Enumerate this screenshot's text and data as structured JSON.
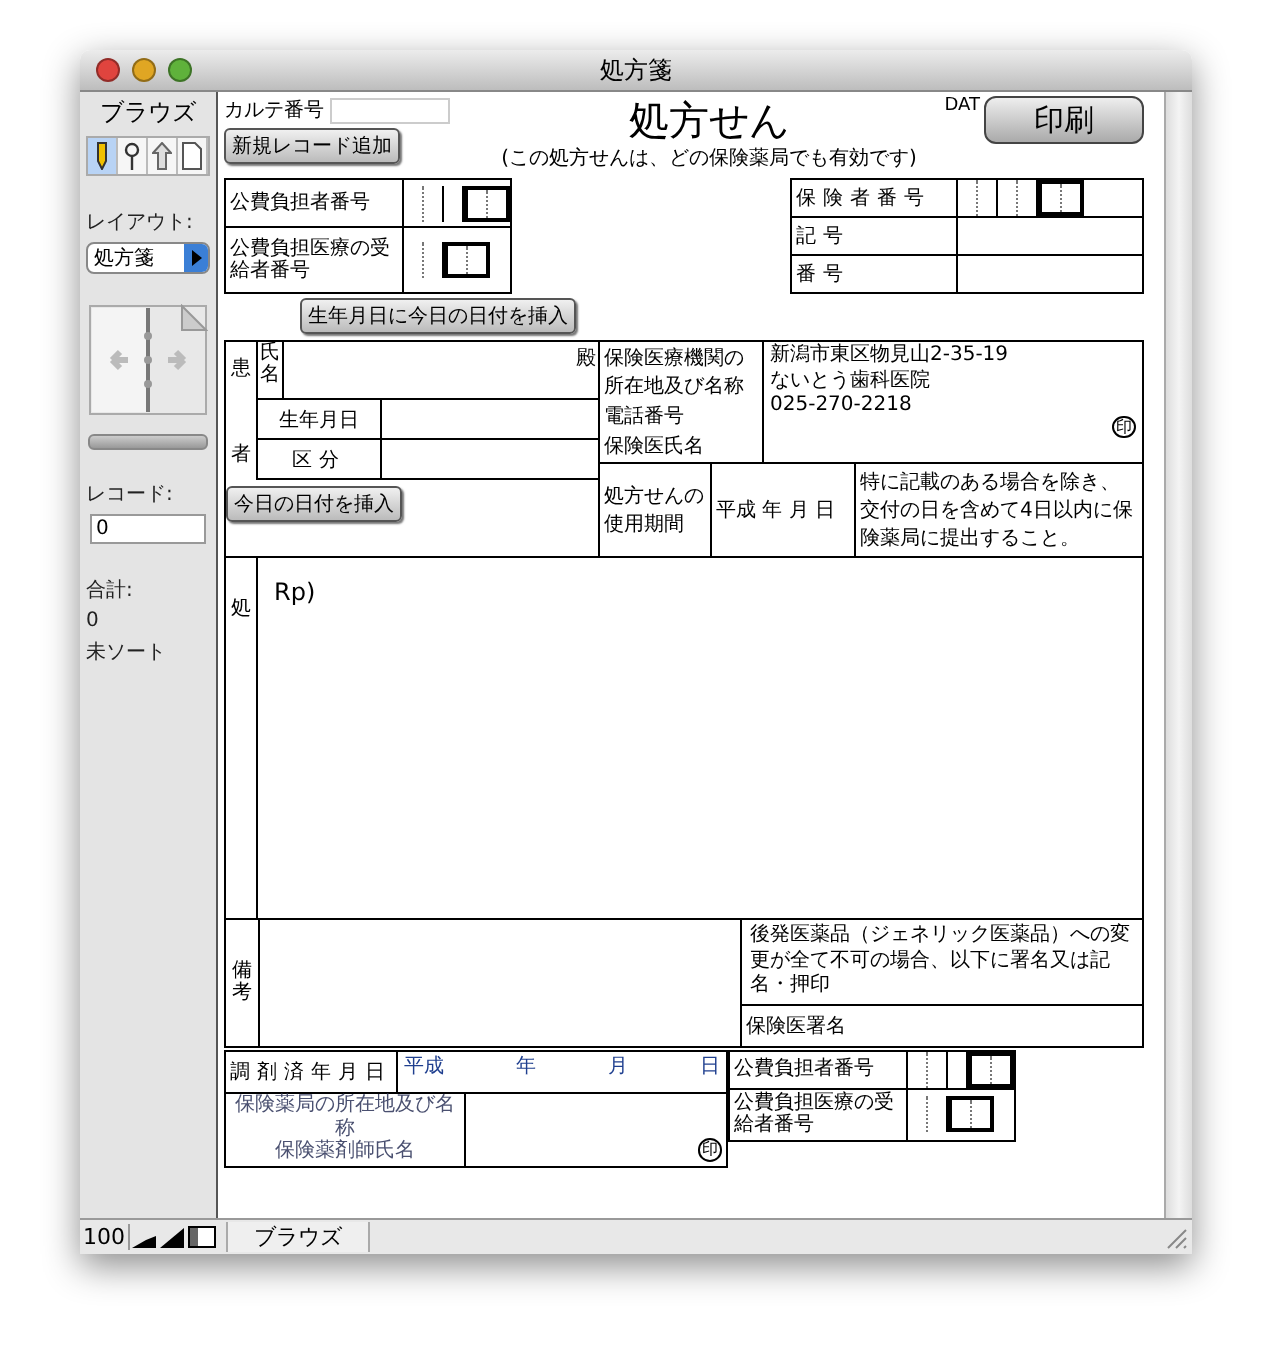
{
  "window": {
    "title": "処方箋"
  },
  "sidebar": {
    "mode_label": "ブラウズ",
    "modes": [
      {
        "kind": "browse",
        "selected": true
      },
      {
        "kind": "find",
        "selected": false
      },
      {
        "kind": "layout",
        "selected": false
      },
      {
        "kind": "preview",
        "selected": false
      }
    ],
    "record_slider": {
      "level": 0
    },
    "layout_label": "レイアウト:",
    "layout_value": "処方箋",
    "record_label": "レコード:",
    "record_value": "0",
    "total_label": "合計:",
    "total_value": "0",
    "sort_status": "未ソート"
  },
  "form": {
    "chart_no_label": "カルテ番号",
    "title": "処方せん",
    "dat_label": "DAT",
    "print_button": "印刷",
    "new_record_button": "新規レコード追加",
    "note": "(この処方せんは、どの保険薬局でも有効です)",
    "public_payer_top": [
      "公費負担者番号",
      "公費負担医療の受給者番号"
    ],
    "insurer": [
      "保険者番号",
      "記号",
      "番号"
    ],
    "birthdate_button": "生年月日に今日の日付を挿入",
    "patient": {
      "side_top": "患",
      "side_bottom": "者",
      "name_label": "氏名",
      "honorific": "殿",
      "birth_label": "生年月日",
      "category_label": "区分",
      "today_button": "今日の日付を挿入"
    },
    "clinic": {
      "labels": [
        "保険医療機関の所在地及び名称",
        "電話番号",
        "保険医氏名"
      ],
      "address": "新潟市東区物見山2-35-19",
      "name": "ないとう歯科医院",
      "phone": "025-270-2218",
      "seal": "印"
    },
    "validity": {
      "label": "処方せんの使用期間",
      "date": "平成 年 月 日",
      "note": "特に記載のある場合を除き、交付の日を含めて4日以内に保険薬局に提出すること。"
    },
    "prescription": {
      "side_label": "処",
      "rp": "Rp)"
    },
    "remarks": {
      "side_label": "備考",
      "generic_note": "後発医薬品（ジェネリック医薬品）への変更が全て不可の場合、以下に署名又は記名・押印",
      "doctor_sign_label": "保険医署名"
    },
    "dispensing": {
      "date_label": "調剤済年月日",
      "era": "平成",
      "year": "年",
      "month": "月",
      "day": "日",
      "pharmacy_label": "保険薬局の所在地及び名称",
      "pharmacist_label": "保険薬剤師氏名",
      "seal": "印"
    },
    "public_payer_bottom": [
      "公費負担者番号",
      "公費負担医療の受給者番号"
    ]
  },
  "status_bar": {
    "zoom": "100",
    "mode": "ブラウズ"
  }
}
